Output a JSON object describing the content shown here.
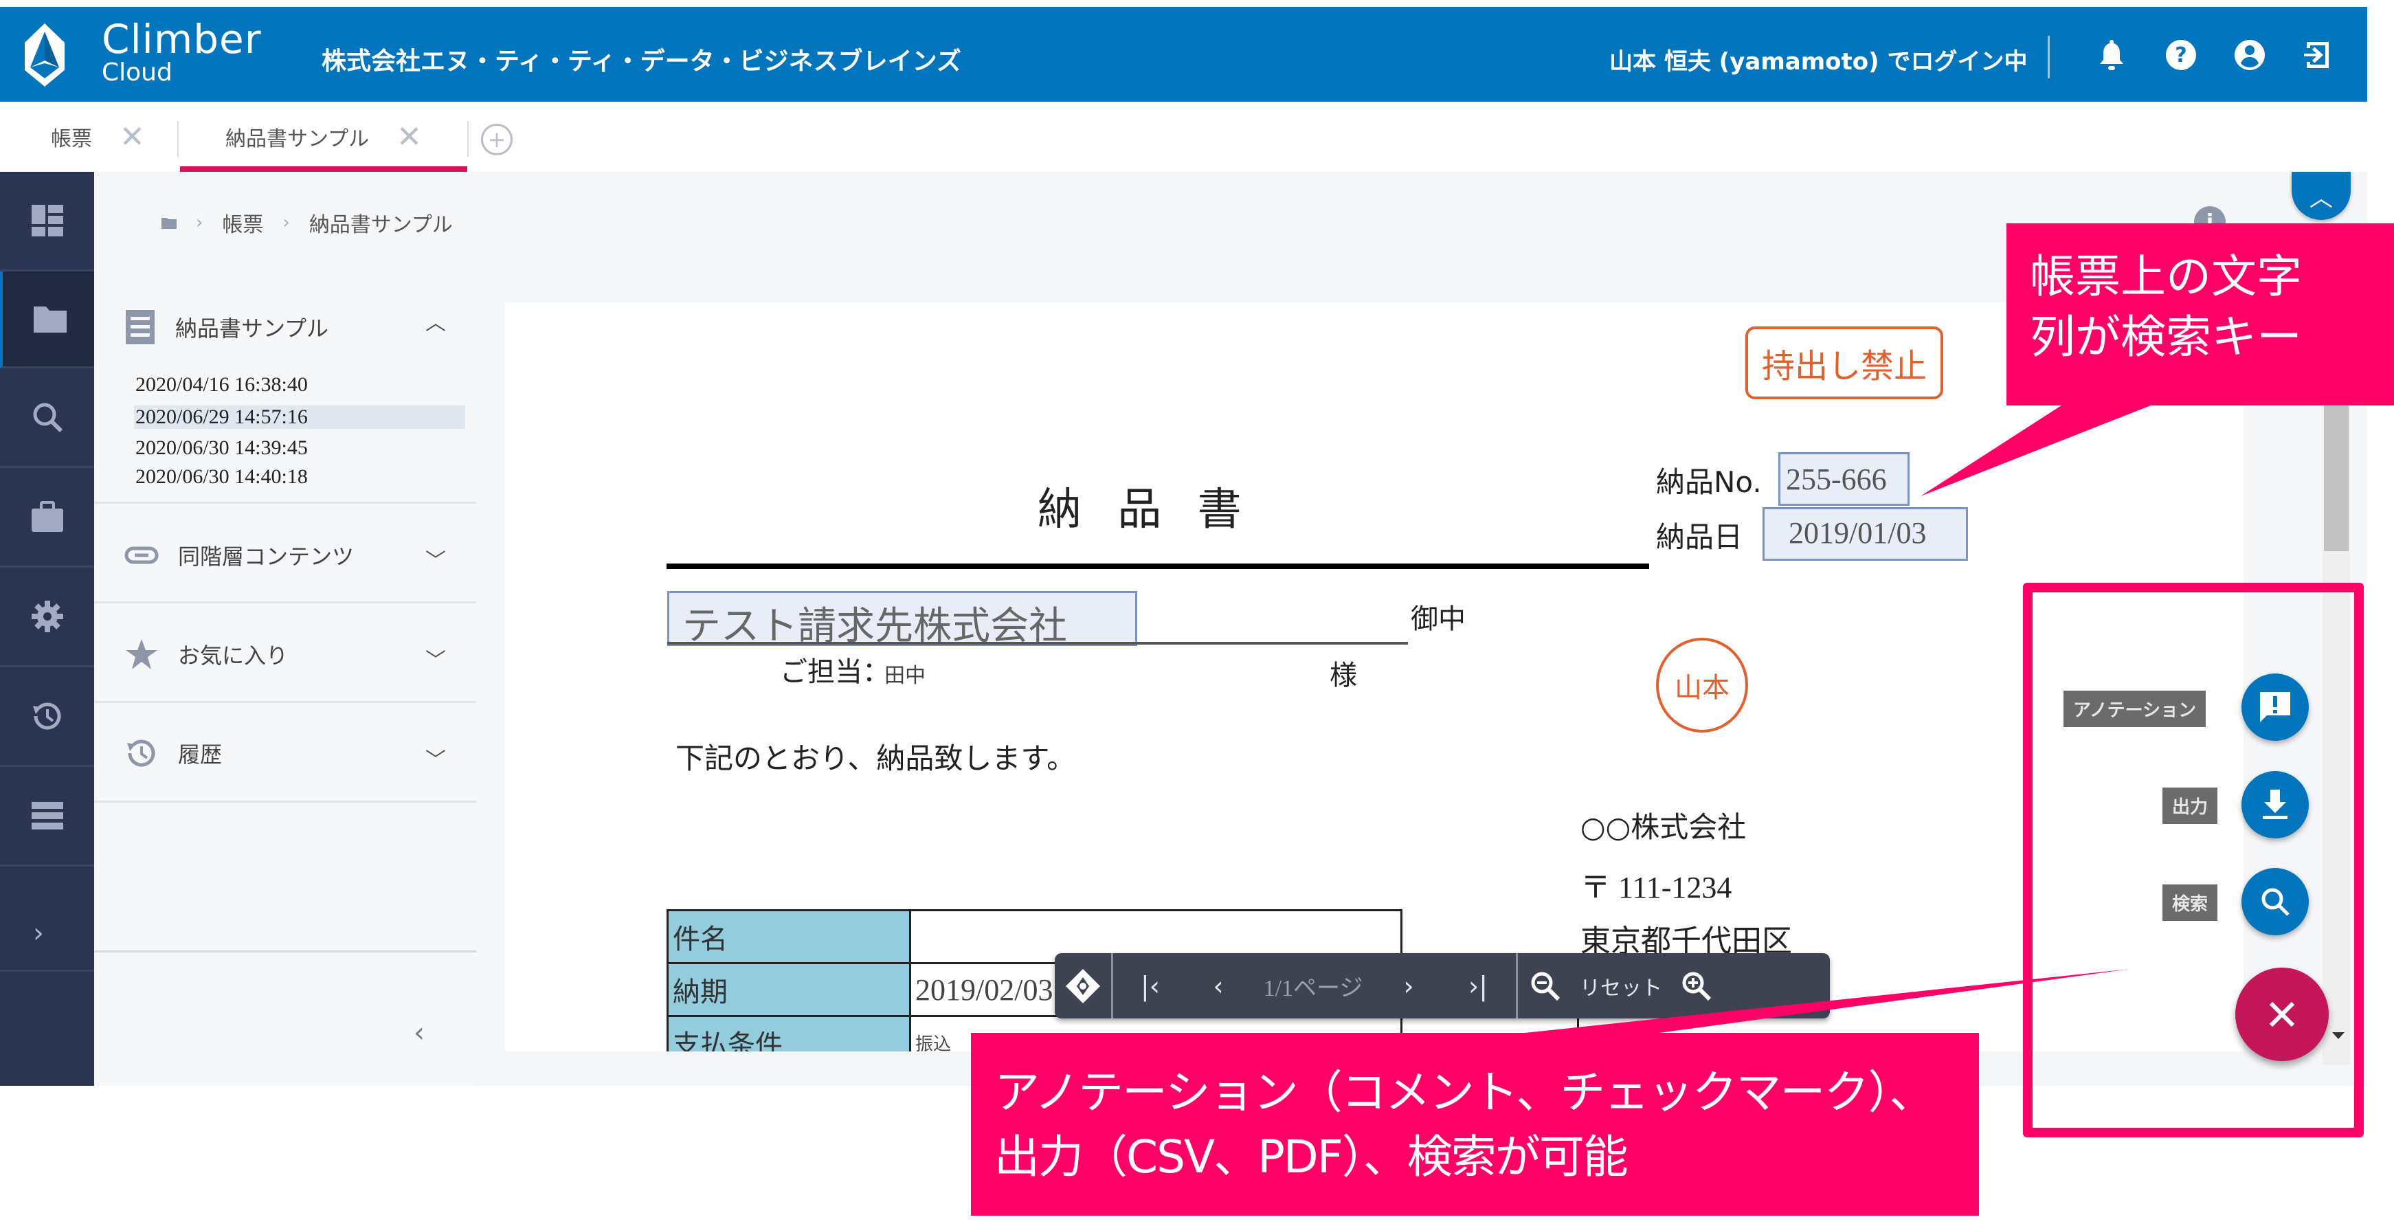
{
  "header": {
    "brand_line1": "Climber",
    "brand_line2": "Cloud",
    "company": "株式会社エヌ・ティ・ティ・データ・ビジネスブレインズ",
    "user_status": "山本 恒夫 (yamamoto) でログイン中",
    "icons": [
      "bell-icon",
      "help-icon",
      "account-icon",
      "logout-icon"
    ]
  },
  "tabs": [
    {
      "label": "帳票",
      "active": false
    },
    {
      "label": "納品書サンプル",
      "active": true
    }
  ],
  "breadcrumb": {
    "items": [
      "帳票",
      "納品書サンプル"
    ]
  },
  "sidebar": {
    "items": [
      "dashboard-icon",
      "folder-icon",
      "search-icon",
      "briefcase-icon",
      "gear-icon",
      "history-icon",
      "list-icon"
    ],
    "active_index": 1
  },
  "left_panel": {
    "document": {
      "title": "納品書サンプル",
      "versions": [
        "2020/04/16 16:38:40",
        "2020/06/29 14:57:16",
        "2020/06/30 14:39:45",
        "2020/06/30 14:40:18"
      ],
      "selected_version": "2020/06/29 14:57:16"
    },
    "sections": [
      {
        "label": "同階層コンテンツ",
        "icon": "link-icon"
      },
      {
        "label": "お気に入り",
        "icon": "star-icon"
      },
      {
        "label": "履歴",
        "icon": "history-icon"
      }
    ]
  },
  "document": {
    "stamp_label": "持出し禁止",
    "title": "納 品 書",
    "delivery_no_label": "納品No.",
    "delivery_no": "255-666",
    "delivery_date_label": "納品日",
    "delivery_date": "2019/01/03",
    "recipient": "テスト請求先株式会社",
    "honorific_company": "御中",
    "contact_label": "ご担当：",
    "contact_name": "田中",
    "honorific_person": "様",
    "seal": "山本",
    "intro": "下記のとおり、納品致します。",
    "sender_company": "○○株式会社",
    "sender_postal": "〒 111-1234",
    "sender_address": "東京都千代田区",
    "table": [
      {
        "label": "件名",
        "value": ""
      },
      {
        "label": "納期",
        "value": "2019/02/03"
      },
      {
        "label": "支払条件",
        "value": "振込"
      }
    ]
  },
  "viewer_toolbar": {
    "move": "move-icon",
    "first": "first-page-icon",
    "prev": "prev-page-icon",
    "page": "1/1ページ",
    "next": "next-page-icon",
    "last": "last-page-icon",
    "zoom_out": "zoom-out-icon",
    "reset": "リセット",
    "zoom_in": "zoom-in-icon"
  },
  "fab": {
    "actions": [
      {
        "label": "アノテーション",
        "icon": "annotation-icon"
      },
      {
        "label": "出力",
        "icon": "download-icon"
      },
      {
        "label": "検索",
        "icon": "search-icon"
      }
    ],
    "close_icon": "close-icon"
  },
  "annotations": {
    "callout_top": [
      "帳票上の文字",
      "列が検索キー"
    ],
    "callout_bottom": [
      "アノテーション（コメント、チェックマーク）、",
      "出力（CSV、PDF）、検索が可能"
    ]
  },
  "colors": {
    "header_blue": "#0275bd",
    "sidebar_navy": "#2b3450",
    "tab_accent": "#d4145a",
    "fab_main": "#c41658",
    "annotation_pink": "#ff0066",
    "stamp_orange": "#e2602d",
    "table_label_bg": "#93cddd"
  }
}
